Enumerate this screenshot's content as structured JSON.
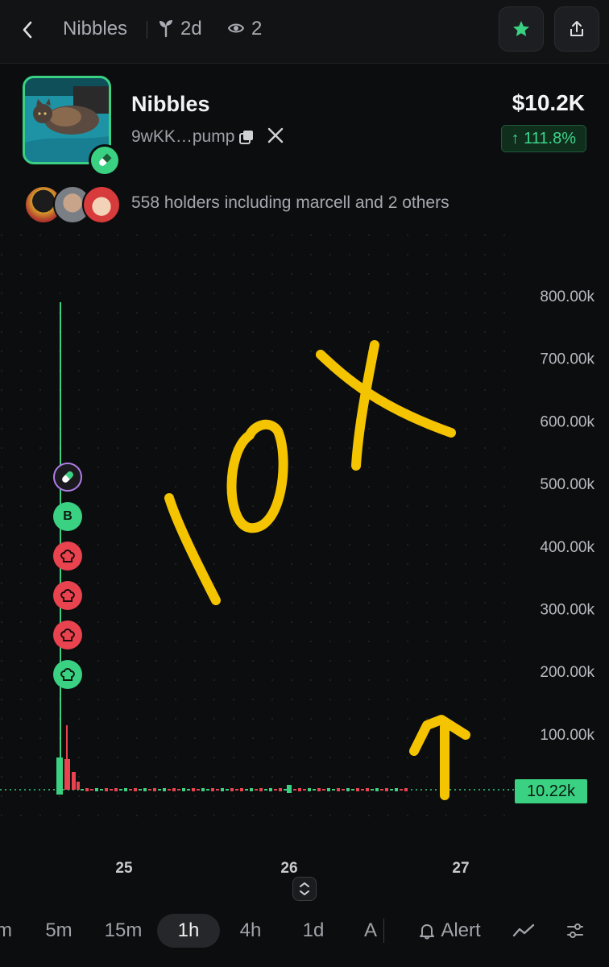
{
  "header": {
    "back_icon": "chevron-left-icon",
    "token_name": "Nibbles",
    "age": "2d",
    "views": "2",
    "star_active_color": "#3ad182"
  },
  "token": {
    "name": "Nibbles",
    "address": "9wKK…pump",
    "market_cap": "$10.2K",
    "change": "↑ 111.8%",
    "holders_text": "558 holders including marcell and 2 others"
  },
  "chart": {
    "y_axis_labels": [
      "800.00k",
      "700.00k",
      "600.00k",
      "500.00k",
      "400.00k",
      "300.00k",
      "200.00k",
      "100.00k"
    ],
    "x_axis_labels": [
      "25",
      "26",
      "27"
    ],
    "current_price_label": "10.22k",
    "up_color": "#3ad182",
    "down_color": "#e8434f",
    "trade_markers": [
      {
        "kind": "pill",
        "label": ""
      },
      {
        "kind": "buy",
        "label": "B"
      },
      {
        "kind": "sell-chef",
        "label": ""
      },
      {
        "kind": "sell-chef",
        "label": ""
      },
      {
        "kind": "sell-chef",
        "label": ""
      },
      {
        "kind": "buy-chef",
        "label": ""
      }
    ]
  },
  "timeframes": {
    "items": [
      "m",
      "5m",
      "15m",
      "1h",
      "4h",
      "1d",
      "A"
    ],
    "selected": "1h",
    "alert_label": "Alert"
  }
}
